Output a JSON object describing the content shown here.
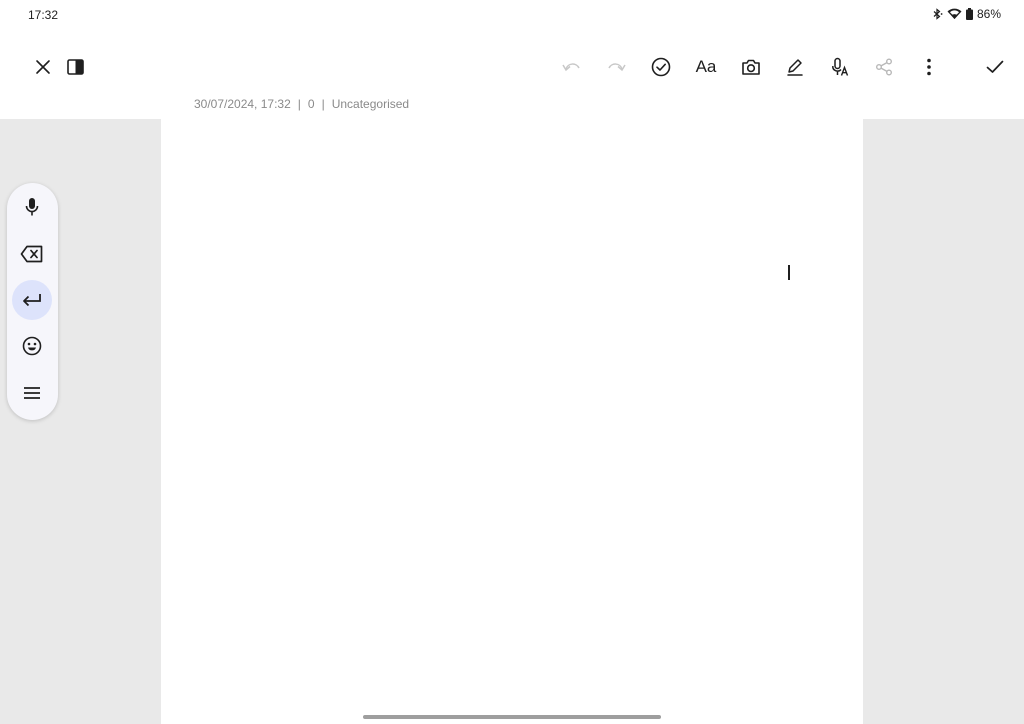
{
  "status_bar": {
    "time": "17:32",
    "battery": "86%",
    "icons": [
      "bluetooth-icon",
      "wifi-icon",
      "battery-icon"
    ]
  },
  "toolbar": {
    "left": [
      "close-icon",
      "side-panel-icon"
    ],
    "right": [
      "undo-icon",
      "redo-icon",
      "checklist-icon",
      "text-format",
      "camera-icon",
      "pen-icon",
      "voice-to-text-icon",
      "share-icon",
      "more-options-icon",
      "done-icon"
    ],
    "text_format_label": "Aa"
  },
  "note_meta": {
    "datetime": "30/07/2024, 17:32",
    "separator": "|",
    "char_count": "0",
    "category": "Uncategorised"
  },
  "palette": {
    "items": [
      "microphone-icon",
      "backspace-icon",
      "enter-icon",
      "emoji-icon",
      "menu-icon"
    ],
    "active": "enter-icon"
  },
  "colors": {
    "canvas_background": "#e9e9e9",
    "page": "#ffffff",
    "palette_active": "#dde3fb",
    "meta_text": "#8a8a8a"
  }
}
